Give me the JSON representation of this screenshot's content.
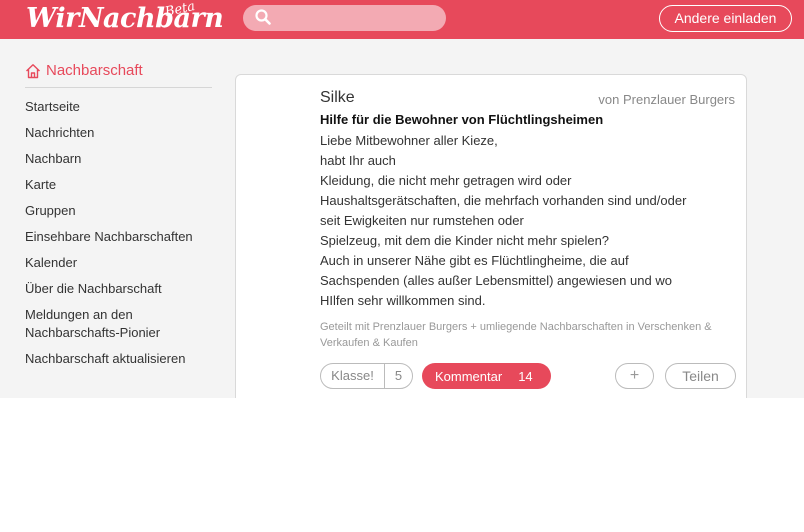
{
  "header": {
    "logo_text": "WirNachbarn",
    "logo_badge": "Beta",
    "search_placeholder": "",
    "invite_label": "Andere einladen"
  },
  "sidebar": {
    "title": "Nachbarschaft",
    "items": [
      {
        "label": "Startseite"
      },
      {
        "label": "Nachrichten"
      },
      {
        "label": "Nachbarn"
      },
      {
        "label": "Karte"
      },
      {
        "label": "Gruppen"
      },
      {
        "label": "Einsehbare Nachbarschaften"
      },
      {
        "label": "Kalender"
      },
      {
        "label": "Über die Nachbarschaft"
      },
      {
        "label": "Meldungen an den Nachbarschafts-Pionier"
      },
      {
        "label": "Nachbarschaft aktualisieren"
      }
    ]
  },
  "post": {
    "author": "Silke",
    "source": "von Prenzlauer Burgers",
    "title": "Hilfe für die Bewohner von Flüchtlingsheimen",
    "body_lines": [
      "Liebe Mitbewohner aller Kieze,",
      "habt Ihr auch",
      "Kleidung, die nicht mehr getragen wird oder",
      "Haushaltsgerätschaften, die mehrfach vorhanden sind und/oder",
      "seit Ewigkeiten nur rumstehen oder",
      "Spielzeug, mit dem die Kinder nicht mehr spielen?",
      "Auch in unserer Nähe gibt es Flüchtlingheime, die auf",
      "Sachspenden (alles außer Lebensmittel) angewiesen und wo",
      "HIlfen sehr willkommen sind."
    ],
    "shared_text": "Geteilt mit Prenzlauer Burgers + umliegende Nachbarschaften in Verschenken & Verkaufen & Kaufen",
    "klasse_label": "Klasse!",
    "klasse_count": "5",
    "comment_label": "Kommentar",
    "comment_count": "14",
    "plus_label": "+",
    "share_label": "Teilen"
  },
  "colors": {
    "brand": "#e7495b"
  }
}
